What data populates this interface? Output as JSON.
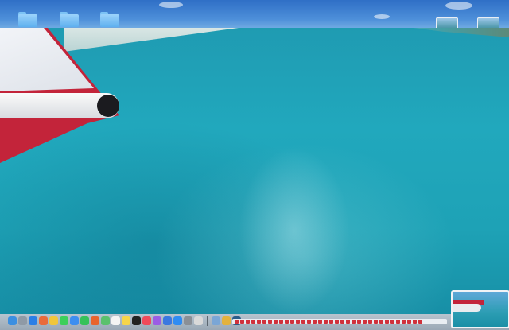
{
  "desktop": {
    "folders": [
      {
        "name": "folder-1"
      },
      {
        "name": "folder-2"
      },
      {
        "name": "folder-3"
      }
    ],
    "window_thumbnails": [
      {
        "name": "window-thumb-1"
      },
      {
        "name": "window-thumb-2"
      }
    ]
  },
  "dock": {
    "apps": [
      {
        "icon": "finder-icon",
        "color": "#3b8fe0"
      },
      {
        "icon": "launchpad-icon",
        "color": "#8f9aa6"
      },
      {
        "icon": "safari-icon",
        "color": "#2a7fe6"
      },
      {
        "icon": "photos-icon",
        "color": "#e96b3a"
      },
      {
        "icon": "chrome-icon",
        "color": "#f0c63a"
      },
      {
        "icon": "messages-icon",
        "color": "#3ccf5a"
      },
      {
        "icon": "mail-icon",
        "color": "#3d8ef0"
      },
      {
        "icon": "facetime-icon",
        "color": "#35c25a"
      },
      {
        "icon": "firefox-icon",
        "color": "#e8642c"
      },
      {
        "icon": "maps-icon",
        "color": "#5ac16c"
      },
      {
        "icon": "calendar-icon",
        "color": "#f4f4f4"
      },
      {
        "icon": "notes-icon",
        "color": "#f6d54a"
      },
      {
        "icon": "appletv-icon",
        "color": "#222222"
      },
      {
        "icon": "music-icon",
        "color": "#f04a5a"
      },
      {
        "icon": "podcasts-icon",
        "color": "#9b5de5"
      },
      {
        "icon": "keynote-icon",
        "color": "#3a78e0"
      },
      {
        "icon": "appstore-icon",
        "color": "#2f8cf2"
      },
      {
        "icon": "settings-icon",
        "color": "#8a8f96"
      },
      {
        "icon": "trash-icon",
        "color": "#d9d9d9"
      }
    ],
    "extras": [
      {
        "icon": "preview-icon",
        "color": "#7aa6d6"
      },
      {
        "icon": "star-icon",
        "color": "#e3b23c"
      },
      {
        "icon": "quicktime-icon",
        "color": "#2c5d8a"
      }
    ],
    "track_ticks": 34
  },
  "colors": {
    "water": "#1ea2b6",
    "wing_red": "#c3243a",
    "wing_white": "#eef1f5"
  }
}
